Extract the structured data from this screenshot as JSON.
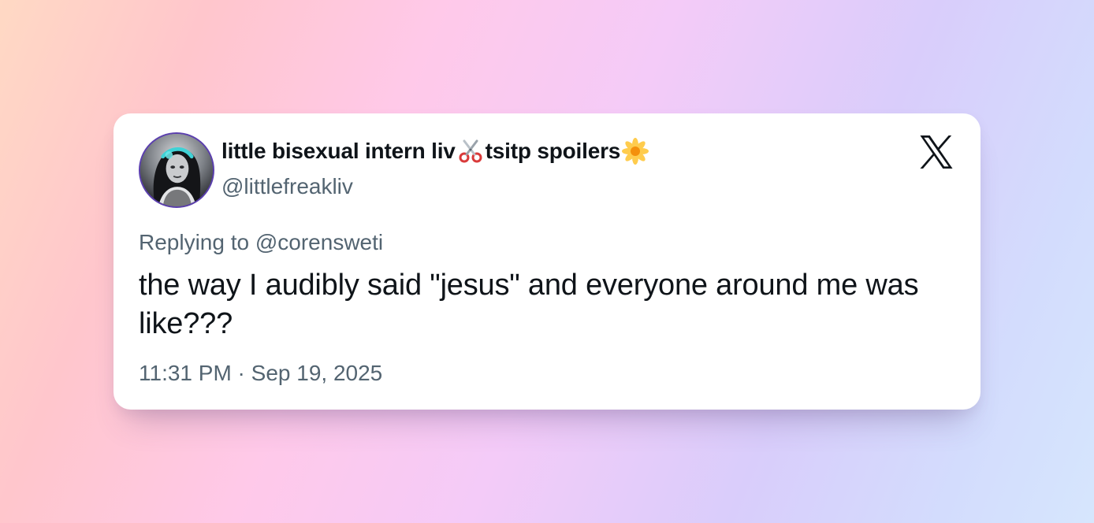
{
  "tweet": {
    "display_name_part1": "little bisexual intern liv",
    "display_name_part2": " tsitp spoilers",
    "emoji_1": "scissors-icon",
    "emoji_2": "blossom-icon",
    "handle": "@littlefreakliv",
    "replying_to": "Replying to @corensweti",
    "text": "the way I audibly said \"jesus\" and everyone around me was like???",
    "timestamp": "11:31 PM · Sep 19, 2025"
  },
  "brand": {
    "logo": "x-logo-icon"
  },
  "colors": {
    "text_primary": "#0f1419",
    "text_secondary": "#536471",
    "avatar_ring": "#5b3fae"
  }
}
